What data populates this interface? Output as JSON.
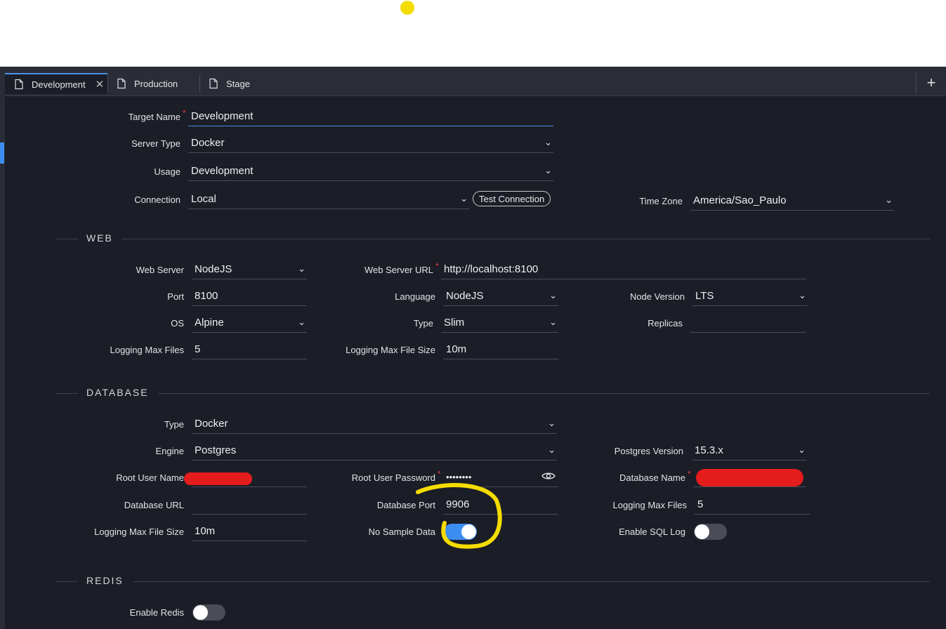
{
  "tabs": [
    {
      "label": "Development",
      "active": true
    },
    {
      "label": "Production",
      "active": false
    },
    {
      "label": "Stage",
      "active": false
    }
  ],
  "general": {
    "target_name_label": "Target Name",
    "target_name_value": "Development",
    "server_type_label": "Server Type",
    "server_type_value": "Docker",
    "usage_label": "Usage",
    "usage_value": "Development",
    "connection_label": "Connection",
    "connection_value": "Local",
    "test_connection_label": "Test Connection",
    "time_zone_label": "Time Zone",
    "time_zone_value": "America/Sao_Paulo"
  },
  "web": {
    "title": "WEB",
    "web_server_label": "Web Server",
    "web_server_value": "NodeJS",
    "web_server_url_label": "Web Server URL",
    "web_server_url_value": "http://localhost:8100",
    "port_label": "Port",
    "port_value": "8100",
    "language_label": "Language",
    "language_value": "NodeJS",
    "node_version_label": "Node Version",
    "node_version_value": "LTS",
    "os_label": "OS",
    "os_value": "Alpine",
    "type_label": "Type",
    "type_value": "Slim",
    "replicas_label": "Replicas",
    "replicas_value": "",
    "logging_max_files_label": "Logging Max Files",
    "logging_max_files_value": "5",
    "logging_max_file_size_label": "Logging Max File Size",
    "logging_max_file_size_value": "10m"
  },
  "database": {
    "title": "DATABASE",
    "type_label": "Type",
    "type_value": "Docker",
    "engine_label": "Engine",
    "engine_value": "Postgres",
    "postgres_version_label": "Postgres Version",
    "postgres_version_value": "15.3.x",
    "root_user_name_label": "Root User Name",
    "root_user_password_label": "Root User Password",
    "root_user_password_value": "••••••••",
    "database_name_label": "Database Name",
    "database_url_label": "Database URL",
    "database_url_value": "",
    "database_port_label": "Database Port",
    "database_port_value": "9906",
    "logging_max_files_label": "Logging Max Files",
    "logging_max_files_value": "5",
    "logging_max_file_size_label": "Logging Max File Size",
    "logging_max_file_size_value": "10m",
    "no_sample_data_label": "No Sample Data",
    "no_sample_data_on": true,
    "enable_sql_log_label": "Enable SQL Log",
    "enable_sql_log_on": false
  },
  "redis": {
    "title": "REDIS",
    "enable_redis_label": "Enable Redis",
    "enable_redis_on": false
  },
  "required_mark": "*",
  "colors": {
    "accent": "#3b8ef0",
    "background": "#1b1d27",
    "highlight": "#f5dc00",
    "required": "#e53a3a"
  }
}
